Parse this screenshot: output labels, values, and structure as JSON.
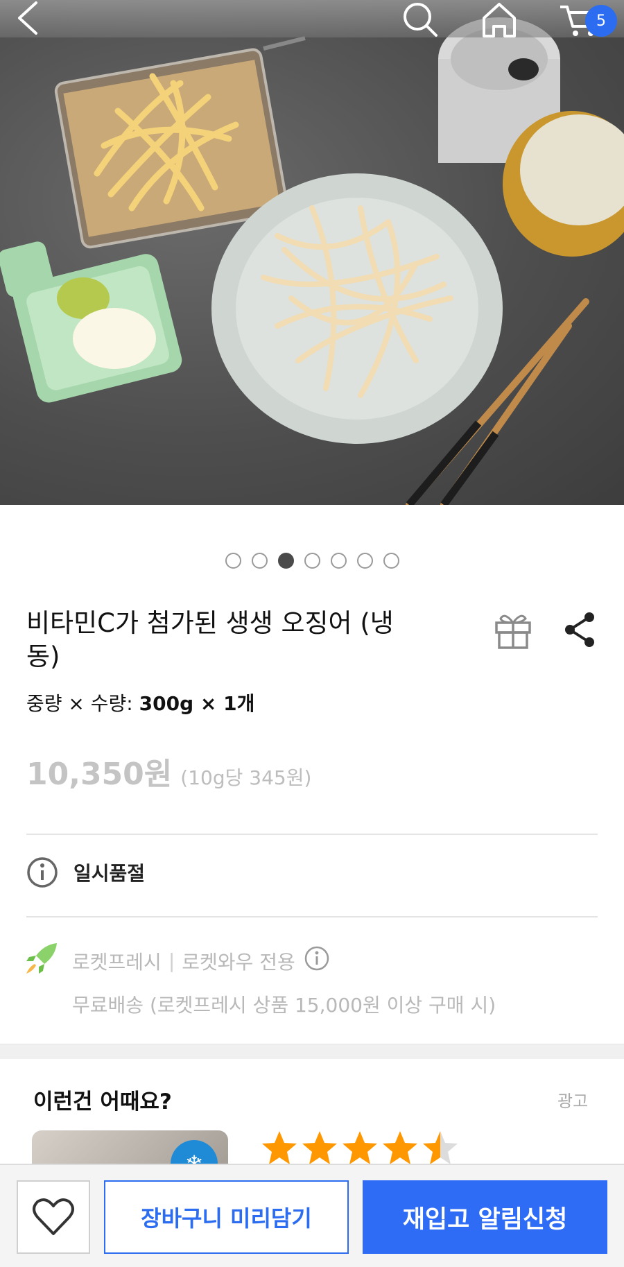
{
  "header": {
    "back_icon": "back-arrow-icon",
    "search_icon": "search-icon",
    "home_icon": "home-icon",
    "cart_icon": "cart-icon",
    "cart_count": "5"
  },
  "gallery": {
    "total_images": 7,
    "active_index": 3
  },
  "product": {
    "title": "비타민C가 첨가된 생생 오징어 (냉동)",
    "spec_label": "중량 × 수량: ",
    "spec_value": "300g × 1개",
    "price": "10,350원",
    "unit_price": "(10g당 345원)"
  },
  "stock": {
    "status": "일시품절"
  },
  "shipping": {
    "badge": "로켓프레시",
    "separator": "|",
    "membership": "로켓와우 전용",
    "free_shipping": "무료배송 (로켓프레시 상품 15,000원 이상 구매 시)"
  },
  "recommend": {
    "title": "이런건 어때요?",
    "ad_label": "광고",
    "rating": 4.5
  },
  "bottom_bar": {
    "wishlist_icon": "heart-icon",
    "add_to_cart": "장바구니 미리담기",
    "restock_alert": "재입고 알림신청"
  },
  "colors": {
    "accent": "#2b6cf0",
    "star": "#ff9800"
  }
}
